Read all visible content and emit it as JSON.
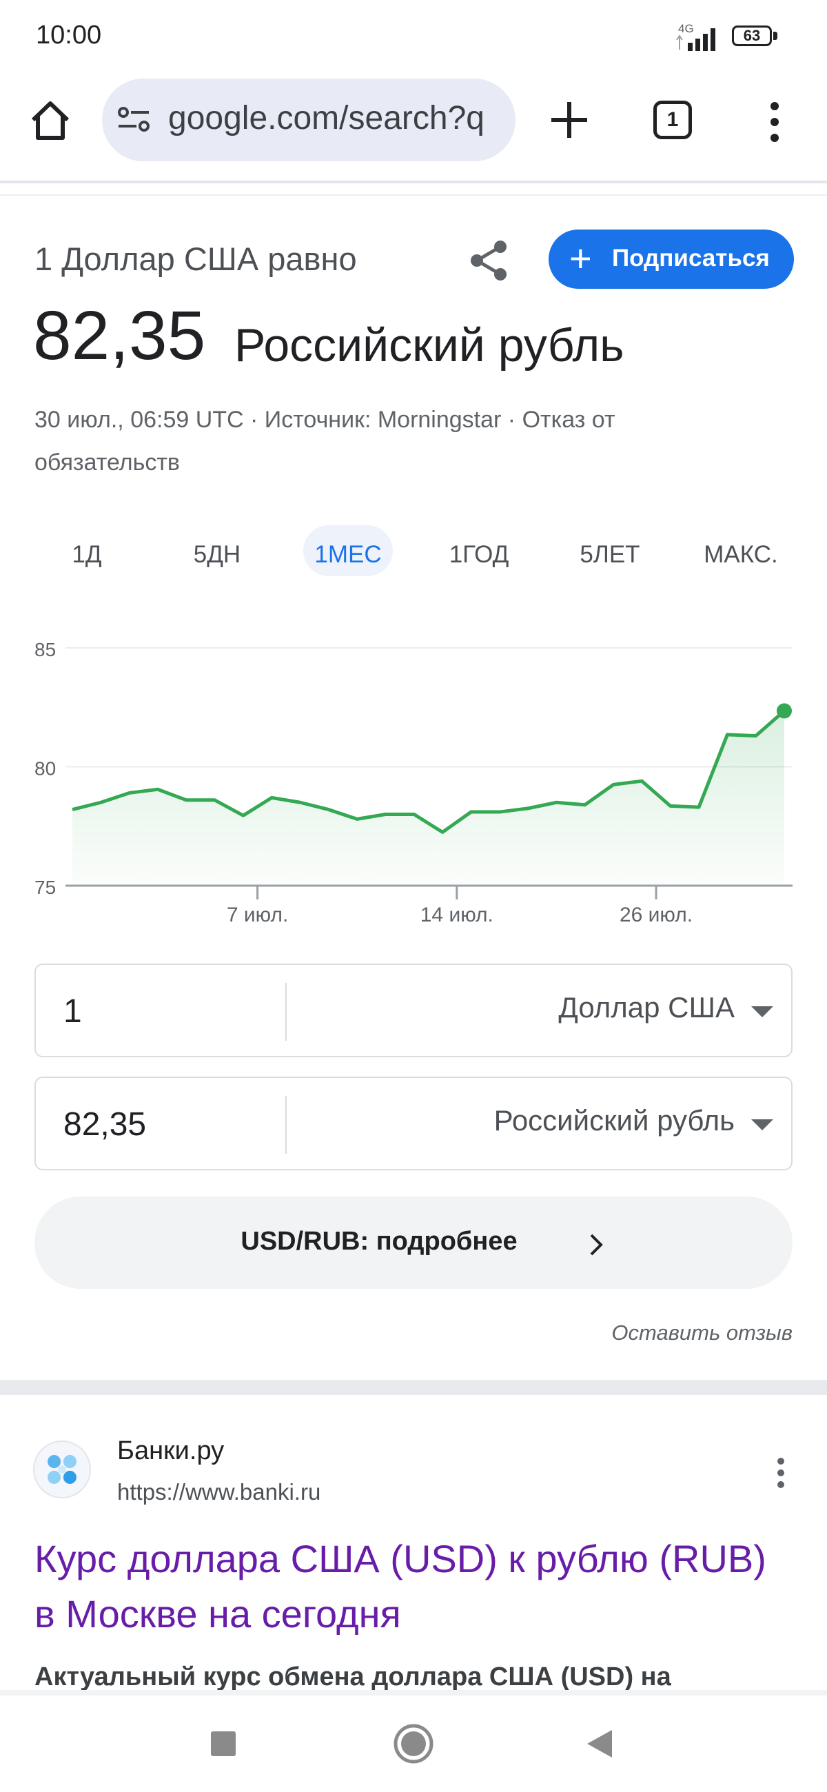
{
  "status_bar": {
    "time": "10:00",
    "network": "4G",
    "battery": "63"
  },
  "browser": {
    "url": "google.com/search?q",
    "tab_count": "1",
    "icons": [
      "home-icon",
      "site-settings-icon",
      "plus-icon",
      "tabs-icon",
      "more-vert-icon"
    ]
  },
  "currency_card": {
    "equals_label": "1 Доллар США равно",
    "subscribe_label": "Подписаться",
    "rate_value": "82,35",
    "rate_currency": "Российский рубль",
    "meta": "30 июл., 06:59 UTC · Источник: Morningstar · Отказ от обязательств",
    "periods": [
      "1Д",
      "5ДН",
      "1МЕС",
      "1ГОД",
      "5ЛЕТ",
      "МАКС."
    ],
    "active_period": "1МЕС",
    "accent_color": "#1a73e8"
  },
  "chart_data": {
    "type": "area",
    "series": [
      {
        "values": [
          78.2,
          78.5,
          78.9,
          79.05,
          78.6,
          78.6,
          77.95,
          78.7,
          78.5,
          78.2,
          77.8,
          78.0,
          78.0,
          77.25,
          78.1,
          78.1,
          78.25,
          78.5,
          78.4,
          79.25,
          79.4,
          78.35,
          78.3,
          81.35,
          81.3,
          82.35
        ]
      }
    ],
    "x_ticks": [
      "7 июл.",
      "14 июл.",
      "26 июл."
    ],
    "x_tick_index": [
      6.5,
      13.5,
      20.5
    ],
    "y_ticks": [
      75,
      80,
      85
    ],
    "ylim": [
      75,
      85
    ],
    "grid": true,
    "line_color": "#34a853"
  },
  "converter": {
    "from_amount": "1",
    "from_currency": "Доллар США",
    "to_amount": "82,35",
    "to_currency": "Российский рубль"
  },
  "details_button": "USD/RUB: подробнее",
  "feedback_link": "Оставить отзыв",
  "result": {
    "site_name": "Банки.ру",
    "site_url": "https://www.banki.ru",
    "title": "Курс доллара США (USD) к рублю (RUB) в Москве на сегодня",
    "snippet": "Актуальный курс обмена доллара США (USD) на"
  },
  "nav_bar": {
    "icons": [
      "recents-icon",
      "home-icon",
      "back-icon"
    ]
  }
}
